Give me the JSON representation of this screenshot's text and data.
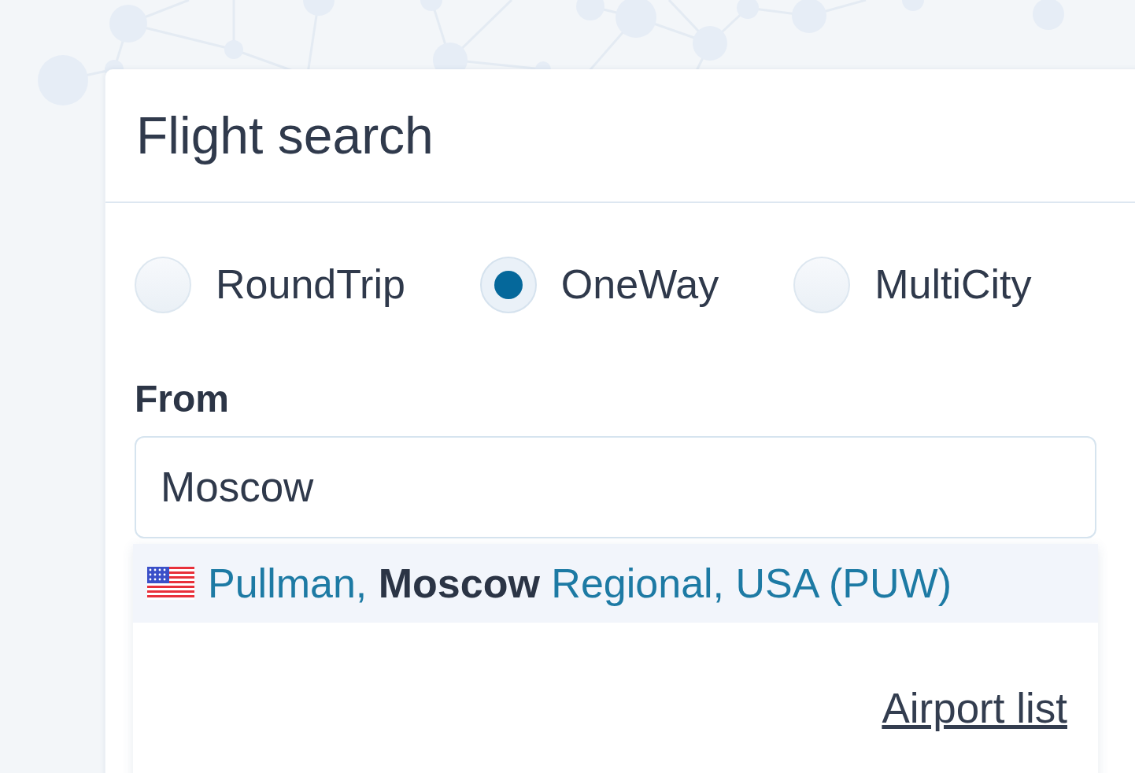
{
  "header": {
    "title": "Flight search"
  },
  "trip_types": [
    {
      "label": "RoundTrip",
      "selected": false
    },
    {
      "label": "OneWay",
      "selected": true
    },
    {
      "label": "MultiCity",
      "selected": false
    }
  ],
  "from": {
    "label": "From",
    "value": "Moscow"
  },
  "suggestions": [
    {
      "text": "Pullman, **Moscow** Regional, USA (PUW)",
      "selected": true
    }
  ],
  "footer": {
    "link": "Airport list"
  }
}
